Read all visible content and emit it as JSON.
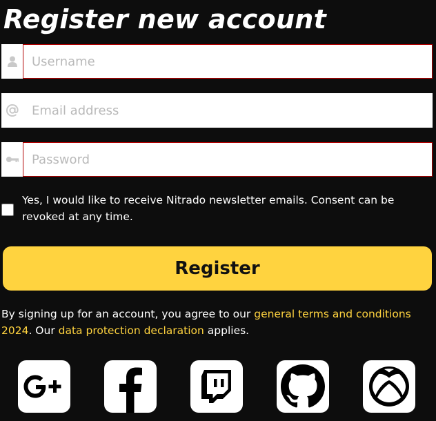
{
  "form": {
    "title": "Register new account",
    "username": {
      "placeholder": "Username",
      "value": "",
      "icon": "user-icon"
    },
    "email": {
      "placeholder": "Email address",
      "value": "",
      "icon": "at-icon"
    },
    "password": {
      "placeholder": "Password",
      "value": "",
      "icon": "key-icon"
    },
    "newsletter": {
      "label": "Yes, I would like to receive Nitrado newsletter emails. Consent can be revoked at any time.",
      "checked": false
    },
    "register_label": "Register",
    "colors": {
      "accent": "#ffd33f",
      "background": "#0d0d0d",
      "error_border": "#b00000"
    }
  },
  "terms": {
    "prefix": "By signing up for an account, you agree to our ",
    "terms_link": "general terms and conditions 2024",
    "middle": ". Our ",
    "privacy_link": "data protection declaration",
    "suffix": " applies."
  },
  "social": [
    {
      "name": "google-plus-icon"
    },
    {
      "name": "facebook-icon"
    },
    {
      "name": "twitch-icon"
    },
    {
      "name": "github-icon"
    },
    {
      "name": "xbox-icon"
    }
  ]
}
